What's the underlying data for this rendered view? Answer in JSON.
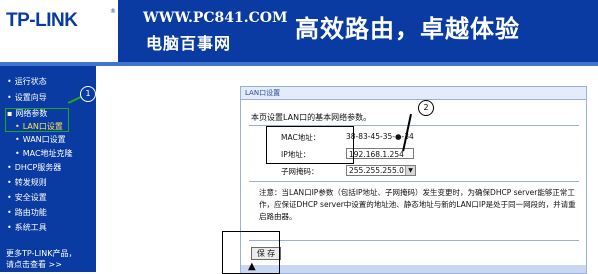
{
  "header": {
    "logo": "TP-LINK",
    "logo_mark": "®",
    "site_url": "WWW.PC841.COM",
    "site_name": "电脑百事网",
    "slogan": "高效路由，卓越体验"
  },
  "sidebar": {
    "items": [
      {
        "label": "运行状态",
        "bullet": "•"
      },
      {
        "label": "设置向导",
        "bullet": "•"
      },
      {
        "label": "网络参数",
        "bullet": "▪"
      },
      {
        "label": "LAN口设置",
        "bullet": "•"
      },
      {
        "label": "WAN口设置",
        "bullet": "•"
      },
      {
        "label": "MAC地址克隆",
        "bullet": "•"
      },
      {
        "label": "DHCP服务器",
        "bullet": "•"
      },
      {
        "label": "转发规则",
        "bullet": "•"
      },
      {
        "label": "安全设置",
        "bullet": "•"
      },
      {
        "label": "路由功能",
        "bullet": "•"
      },
      {
        "label": "系统工具",
        "bullet": "•"
      }
    ],
    "more_line1": "更多TP-LINK产品，",
    "more_line2": "请点击查看 >>",
    "annotation_1": "1"
  },
  "panel": {
    "title": "LAN口设置",
    "description": "本页设置LAN口的基本网络参数。",
    "mac_label": "MAC地址：",
    "mac_value": "38-83-45-35-●-34",
    "ip_label": "IP地址：",
    "ip_value": "192.168.1.254",
    "mask_label": "子网掩码：",
    "mask_value": "255.255.255.0",
    "note": "注意：当LAN口IP参数（包括IP地址、子网掩码）发生变更时，为确保DHCP server能够正常工作，应保证DHCP server中设置的地址池、静态地址与新的LAN口IP是处于同一网段的，并请重启路由器。",
    "save_label": "保 存",
    "annotation_2": "2"
  },
  "colors": {
    "header_blue": "#0a3ba3",
    "sidebar_active": "#ffe25a",
    "annotation_green": "#1fa81f"
  }
}
